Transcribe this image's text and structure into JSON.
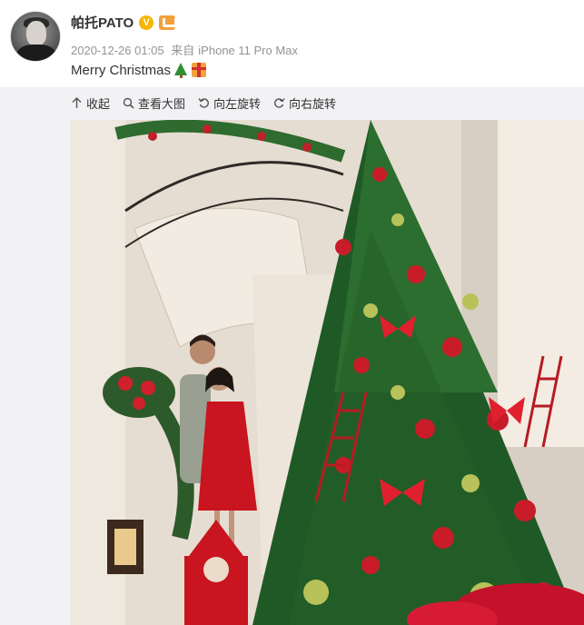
{
  "post": {
    "user_name": "帕托PATO",
    "verified_badge": "V",
    "timestamp": "2020-12-26 01:05",
    "source_prefix": "来自",
    "source_device": "iPhone 11 Pro Max",
    "text": "Merry Christmas"
  },
  "toolbar": {
    "collapse_label": "收起",
    "view_large_label": "查看大图",
    "rotate_left_label": "向左旋转",
    "rotate_right_label": "向右旋转"
  },
  "icons": {
    "avatar": "avatar-image",
    "verified": "verified-icon",
    "member": "member-icon",
    "emoji1": "christmas-tree-emoji",
    "emoji2": "gift-emoji"
  },
  "colors": {
    "accent_orange": "#f7b500",
    "text": "#333333",
    "meta": "#939393",
    "media_bg": "#f2f2f5"
  }
}
